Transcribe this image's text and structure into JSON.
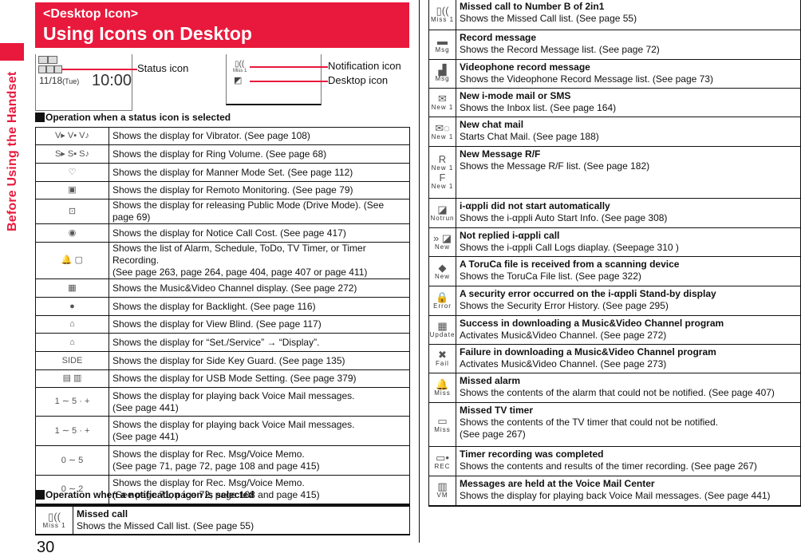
{
  "side_label": "Before Using the Handset",
  "header": {
    "subtitle": "<Desktop Icon>",
    "title": "Using Icons on Desktop"
  },
  "figure": {
    "screen1": {
      "date": "11/18",
      "day": "(Tue)",
      "time": "10:00"
    },
    "screen2": {
      "notification_caption": "Miss 1"
    },
    "callouts": {
      "status_icon": "Status icon",
      "notification_icon": "Notification icon",
      "desktop_icon": "Desktop icon"
    }
  },
  "status_section": {
    "heading": "Operation when a status icon is selected",
    "rows": [
      {
        "icon": "vibrator-icons",
        "glyph": "V▸ V▪ V♪",
        "lines": [
          "Shows the display for Vibrator. (See page 108)"
        ]
      },
      {
        "icon": "ring-volume-icons",
        "glyph": "S▸ S▪ S♪",
        "lines": [
          "Shows the display for Ring Volume. (See page 68)"
        ]
      },
      {
        "icon": "manner-mode-icon",
        "glyph": "♡",
        "lines": [
          "Shows the display for Manner Mode Set. (See page 112)"
        ]
      },
      {
        "icon": "remote-monitoring-icon",
        "glyph": "▣",
        "lines": [
          "Shows the display for Remoto Monitoring. (See page 79)"
        ]
      },
      {
        "icon": "drive-mode-icon",
        "glyph": "⊡",
        "lines": [
          "Shows the display for releasing Public Mode (Drive Mode). (See page 69)"
        ]
      },
      {
        "icon": "call-cost-icon",
        "glyph": "◉",
        "lines": [
          "Shows the display for Notice Call Cost. (See page 417)"
        ]
      },
      {
        "icon": "alarm-schedule-icons",
        "glyph": "🔔 ▢",
        "lines": [
          "Shows the list of Alarm, Schedule, ToDo, TV Timer, or Timer Recording.",
          "(See page 263, page 264, page 404, page 407 or page 411)"
        ]
      },
      {
        "icon": "music-video-channel-icon",
        "glyph": "▦",
        "lines": [
          "Shows the Music&Video Channel display. (See page 272)"
        ]
      },
      {
        "icon": "backlight-icon",
        "glyph": "●",
        "lines": [
          "Shows the display for Backlight. (See page 116)"
        ]
      },
      {
        "icon": "view-blind-icon",
        "glyph": "⌂",
        "lines": [
          "Shows the display for View Blind. (See page 117)"
        ]
      },
      {
        "icon": "display-setting-icon",
        "glyph": "⌂",
        "lines": [
          "Shows the display for “Set./Service” → “Display”."
        ]
      },
      {
        "icon": "side-key-guard-icon",
        "glyph": "SIDE",
        "lines": [
          "Shows the display for Side Key Guard. (See page 135)"
        ]
      },
      {
        "icon": "usb-mode-icons",
        "glyph": "▤ ▥",
        "lines": [
          "Shows the display for USB Mode Setting. (See page 379)"
        ]
      },
      {
        "icon": "voice-mail-icons",
        "glyph": "1 ∼ 5 · +",
        "lines": [
          "Shows the display for playing back Voice Mail messages.",
          "(See page 441)"
        ]
      },
      {
        "icon": "voice-mail-b-icons",
        "glyph": "1 ∼ 5 · +",
        "lines": [
          "Shows the display for playing back Voice Mail messages.",
          "(See page 441)"
        ]
      },
      {
        "icon": "rec-msg-icons",
        "glyph": "0 ∼ 5",
        "lines": [
          "Shows the display for Rec. Msg/Voice Memo.",
          "(See page 71, page 72, page 108 and page 415)"
        ]
      },
      {
        "icon": "voice-memo-icons",
        "glyph": "0 ∼ 2",
        "lines": [
          "Shows the display for Rec. Msg/Voice Memo.",
          "(See page 71, page 72, page 108 and page 415)"
        ]
      }
    ]
  },
  "notification_section": {
    "heading": "Operation when a notification icon is selected",
    "rows_left": [
      {
        "icon": "missed-call-icon",
        "glyph": "▯((",
        "caption": "Miss 1",
        "title": "Missed call",
        "lines": [
          "Shows the Missed Call list. (See page 55)"
        ]
      }
    ],
    "rows_right": [
      {
        "icon": "missed-call-b-icon",
        "glyph": "▯((",
        "caption": "Miss 1",
        "title": "Missed call to Number B of 2in1",
        "lines": [
          "Shows the Missed Call list. (See page 55)"
        ]
      },
      {
        "icon": "record-message-icon",
        "glyph": "▬",
        "caption": "Msg",
        "title": "Record message",
        "lines": [
          "Shows the Record Message list. (See page 72)"
        ]
      },
      {
        "icon": "videophone-message-icon",
        "glyph": "▟",
        "caption": "Msg",
        "title": "Videophone record message",
        "lines": [
          "Shows the Videophone Record Message list. (See page 73)"
        ]
      },
      {
        "icon": "new-mail-icon",
        "glyph": "✉",
        "caption": "New 1",
        "title": "New i-mode mail or SMS",
        "lines": [
          "Shows the Inbox list. (See page 164)"
        ]
      },
      {
        "icon": "chat-mail-icon",
        "glyph": "✉◌",
        "caption": "New 1",
        "title": "New chat mail",
        "lines": [
          "Starts Chat Mail. (See page 188)"
        ]
      },
      {
        "icon": "message-rf-icon",
        "glyph": "R",
        "caption": "New 1",
        "glyph2": "F",
        "caption2": "New 1",
        "title": "New Message R/F",
        "lines": [
          "Shows the Message R/F list. (See page 182)"
        ]
      },
      {
        "icon": "iappli-notrun-icon",
        "glyph": "◪",
        "caption": "Notrun",
        "title": "i-αppli did not start automatically",
        "lines": [
          "Shows the i-αppli Auto Start Info. (See page 308)"
        ]
      },
      {
        "icon": "iappli-call-icon",
        "glyph": "» ◪",
        "caption": "New",
        "title": "Not replied i-αppli call",
        "lines": [
          "Shows the i-αppli Call Logs diaplay. (Seepage 310 )"
        ]
      },
      {
        "icon": "toruca-icon",
        "glyph": "◆",
        "caption": "New",
        "title": "A ToruCa file is received from a scanning device",
        "lines": [
          "Shows the ToruCa File list. (See page 322)"
        ]
      },
      {
        "icon": "security-error-icon",
        "glyph": "🔒",
        "caption": "Error",
        "title": "A security error occurred on the i-αppli Stand-by display",
        "lines": [
          "Shows the Security Error History. (See page 295)"
        ]
      },
      {
        "icon": "channel-update-icon",
        "glyph": "▦",
        "caption": "Update",
        "title": "Success in downloading a Music&Video Channel program",
        "lines": [
          "Activates Music&Video Channel. (See page 272)"
        ]
      },
      {
        "icon": "channel-fail-icon",
        "glyph": "✖",
        "caption": "Fail",
        "title": "Failure in downloading a Music&Video Channel program",
        "lines": [
          "Activates Music&Video Channel. (See page 273)"
        ]
      },
      {
        "icon": "missed-alarm-icon",
        "glyph": "🔔",
        "caption": "Miss",
        "title": "Missed alarm",
        "lines": [
          "Shows the contents of the alarm that could not be notified. (See page 407)"
        ]
      },
      {
        "icon": "missed-tv-timer-icon",
        "glyph": "▭",
        "caption": "Miss",
        "title": "Missed TV timer",
        "lines": [
          "Shows the contents of the TV timer that could not be notified.",
          "(See page 267)"
        ]
      },
      {
        "icon": "timer-recording-icon",
        "glyph": "▭•",
        "caption": "REC",
        "title": "Timer recording was completed",
        "lines": [
          "Shows the contents and results of the timer recording. (See page 267)"
        ]
      },
      {
        "icon": "voice-mail-center-icon",
        "glyph": "▥",
        "caption": "VM",
        "title": "Messages are held at the Voice Mail Center",
        "lines": [
          "Shows the display for playing back Voice Mail messages. (See page 441)"
        ]
      }
    ]
  },
  "page_number": "30",
  "colors": {
    "accent": "#e8193c",
    "text": "#111111"
  }
}
